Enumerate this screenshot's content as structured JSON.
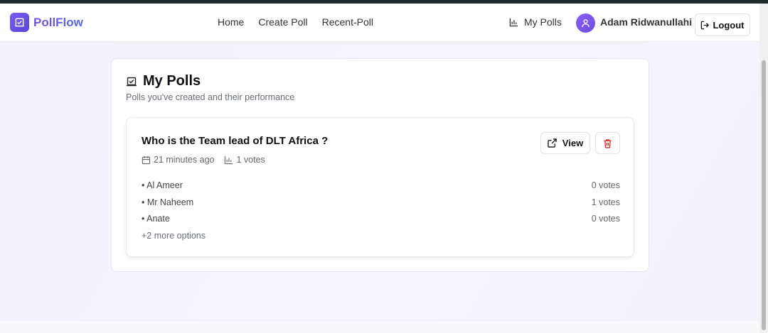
{
  "app": {
    "name": "PollFlow"
  },
  "nav": {
    "links": [
      "Home",
      "Create Poll",
      "Recent-Poll"
    ],
    "my_polls": "My Polls",
    "user_name": "Adam Ridwanullahi",
    "logout": "Logout"
  },
  "section": {
    "title": "My Polls",
    "subtitle": "Polls you've created and their performance"
  },
  "poll": {
    "question": "Who is the Team lead of DLT Africa ?",
    "time_ago": "21 minutes ago",
    "votes": "1 votes",
    "view_label": "View",
    "options": [
      {
        "label": "• Al Ameer",
        "votes": "0 votes"
      },
      {
        "label": "• Mr Naheem",
        "votes": "1 votes"
      },
      {
        "label": "• Anate",
        "votes": "0 votes"
      }
    ],
    "more": "+2 more options"
  },
  "colors": {
    "brand": "#6f50e8",
    "delete": "#dc2626"
  },
  "icons": [
    "vote-box-icon",
    "bar-chart-icon",
    "user-icon",
    "logout-icon",
    "calendar-icon",
    "external-link-icon",
    "trash-icon"
  ]
}
